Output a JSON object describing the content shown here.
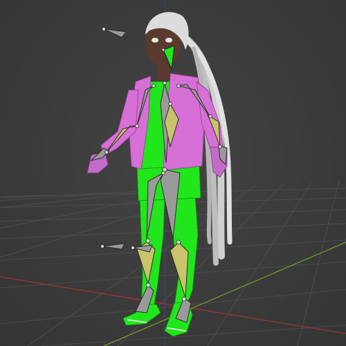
{
  "app": {
    "name": "",
    "view": "3D Viewport"
  },
  "scene": {
    "object_name": "",
    "armature_name": "",
    "mode": "",
    "colors": {
      "background": "#3a3a3a",
      "grid": "#505050",
      "x_axis": "#9b3434",
      "y_axis": "#6f9a2a",
      "z_axis": "#3b5f9a",
      "jacket": "#d66fd6",
      "outfit_green": "#22e61c",
      "skin": "#5a3a2e",
      "hair": "#d8d8d8",
      "bone_fill": "#9a9a9a",
      "bone_selected": "#c9c36a",
      "bone_outline": "#2b2b2b"
    },
    "icons": [
      "empty-icon",
      "armature-icon"
    ]
  }
}
